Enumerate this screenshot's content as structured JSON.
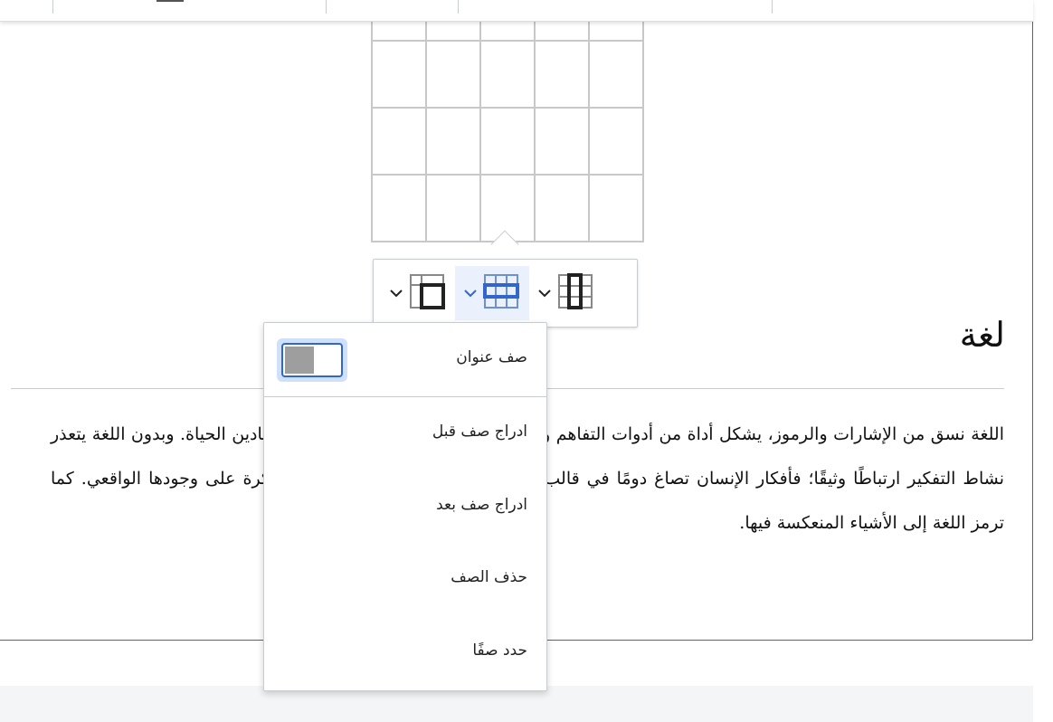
{
  "icons": {
    "column_menu": "table-column-icon",
    "row_menu": "table-row-icon",
    "merge_menu": "table-merge-icon",
    "chevron": "chevron-down-icon"
  },
  "colors": {
    "accent": "#3366cc",
    "active_bg": "#eaf1fd"
  },
  "article": {
    "heading": "لغة",
    "paragraph": "اللغة نسق من الإشارات والرموز، يشكل أداة من أدوات التفاهم والاحتكاك بين أفراد المجتمع في جميع ميادين الحياة. وبدون اللغة يتعذر نشاط التفكير ارتباطًا وثيقًا؛ فأفكار الإنسان تصاغ دومًا في قالب لغوي، حتى في حال تفكير يحصل الفكرة على وجودها الواقعي. كما ترمز اللغة إلى الأشياء المنعكسة فيها."
  },
  "table": {
    "rows": 4,
    "cols": 5
  },
  "row_menu": {
    "header_row_label": "صف عنوان",
    "header_row_on": true,
    "items": [
      "ادراج صف قبل",
      "ادراج صف بعد",
      "حذف الصف",
      "حدد صفًا"
    ]
  }
}
